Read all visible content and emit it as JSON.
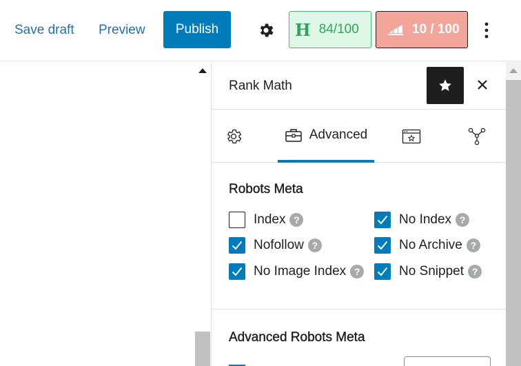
{
  "toolbar": {
    "save_draft": "Save draft",
    "preview": "Preview",
    "publish": "Publish",
    "settings_icon": "gear-icon",
    "seo_score_letter": "H",
    "seo_score": "84/100",
    "content_score": "10 / 100",
    "more_icon": "kebab-menu-icon"
  },
  "sidebar": {
    "title": "Rank Math",
    "star_icon": "star-icon",
    "close_icon": "close-icon",
    "tabs": [
      {
        "icon": "gear-icon",
        "label": ""
      },
      {
        "icon": "briefcase-icon",
        "label": "Advanced",
        "active": true
      },
      {
        "icon": "schema-icon",
        "label": ""
      },
      {
        "icon": "social-share-icon",
        "label": ""
      }
    ]
  },
  "robots_meta": {
    "title": "Robots Meta",
    "options": [
      {
        "label": "Index",
        "checked": false
      },
      {
        "label": "No Index",
        "checked": true
      },
      {
        "label": "Nofollow",
        "checked": true
      },
      {
        "label": "No Archive",
        "checked": true
      },
      {
        "label": "No Image Index",
        "checked": true
      },
      {
        "label": "No Snippet",
        "checked": true
      }
    ],
    "help_glyph": "?"
  },
  "advanced_robots_meta": {
    "title": "Advanced Robots Meta"
  },
  "colors": {
    "accent": "#007cba",
    "seo_good_bg": "#dff7e6",
    "seo_good_text": "#2ca55a",
    "content_bad_bg": "#f2a59b"
  }
}
